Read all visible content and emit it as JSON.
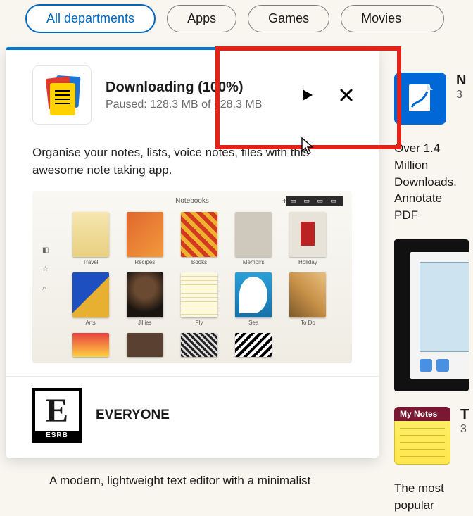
{
  "tabs": {
    "all": "All departments",
    "apps": "Apps",
    "games": "Games",
    "movies": "Movies"
  },
  "main_card": {
    "title": "Downloading (100%)",
    "status": "Paused: 128.3 MB of 128.3 MB",
    "description": "Organise your notes, lists, voice notes, files with this awesome note taking app.",
    "screenshot_title": "Notebooks",
    "screenshot_labels": [
      "Travel",
      "Recipes",
      "Books",
      "Memoirs",
      "Holiday",
      "Arts",
      "Jillies",
      "Fly",
      "Sea",
      "To Do"
    ],
    "rating_letter": "E",
    "rating_org": "ESRB",
    "rating_label": "EVERYONE"
  },
  "below_text": "A modern, lightweight text editor with a minimalist",
  "side1": {
    "title": "N",
    "sub": "3",
    "desc": "Over 1.4 Million Downloads. Annotate PDF"
  },
  "side2": {
    "notes_header": "My Notes",
    "title": "T",
    "sub": "3",
    "desc": "The most popular"
  }
}
